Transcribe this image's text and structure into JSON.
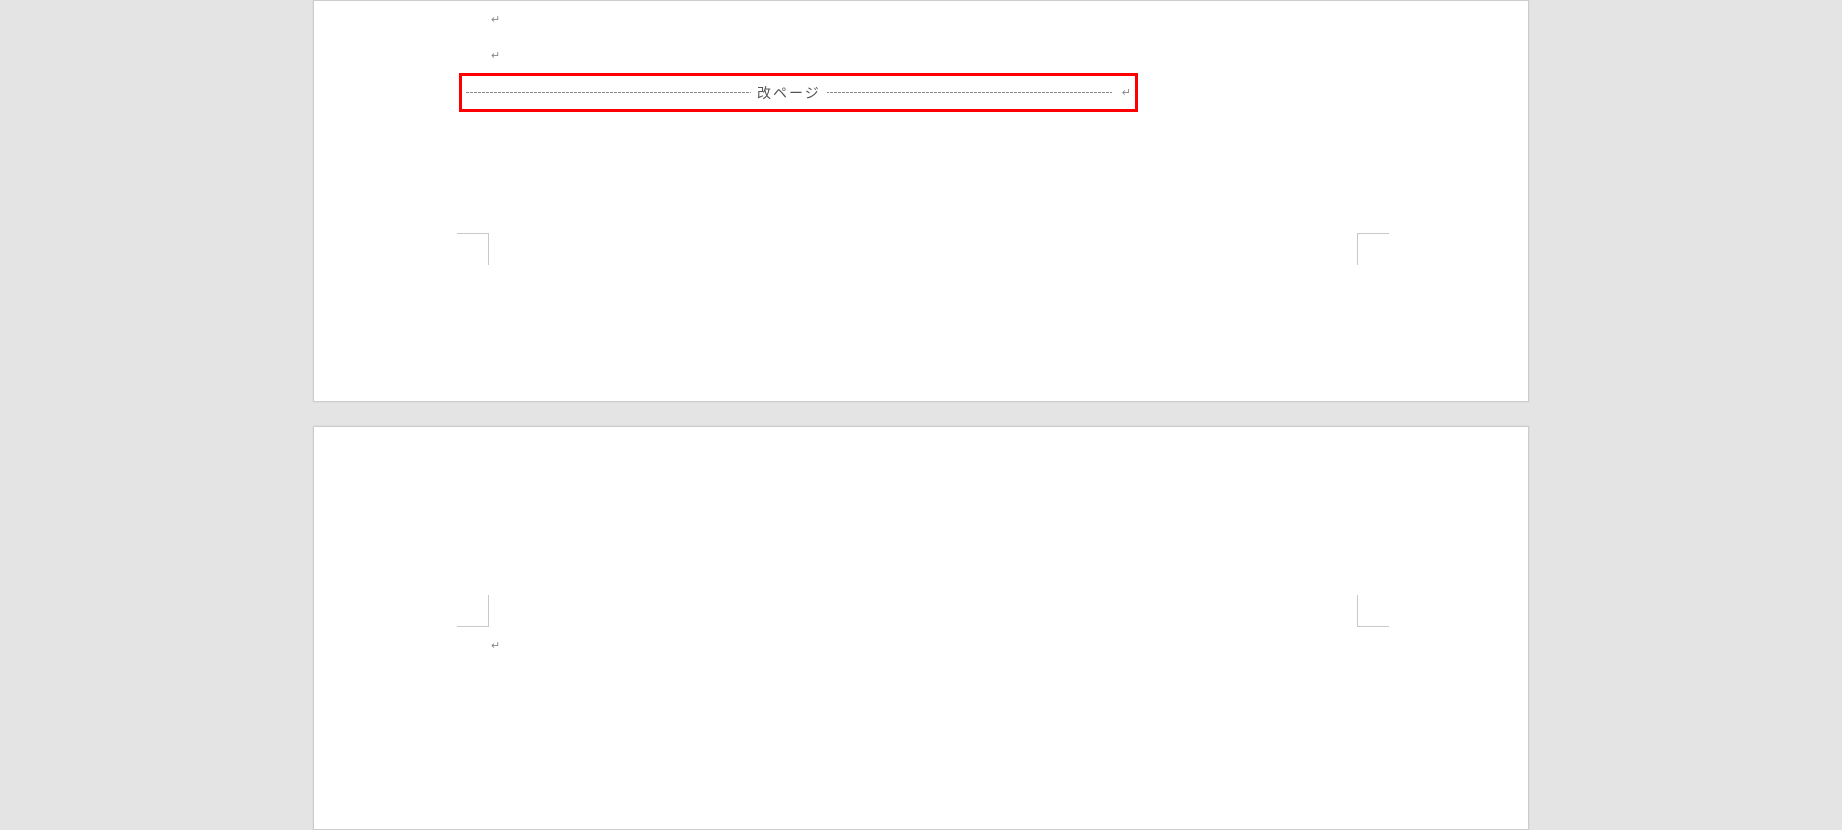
{
  "document": {
    "paragraph_mark": "↵",
    "page_break_label": "改ページ",
    "page_break_mark": "↵",
    "highlight_color": "#ff0000"
  },
  "page1": {
    "lines": [
      {
        "mark": "↵"
      },
      {
        "mark": "↵"
      }
    ]
  },
  "page2": {
    "lines": [
      {
        "mark": "↵"
      }
    ]
  }
}
